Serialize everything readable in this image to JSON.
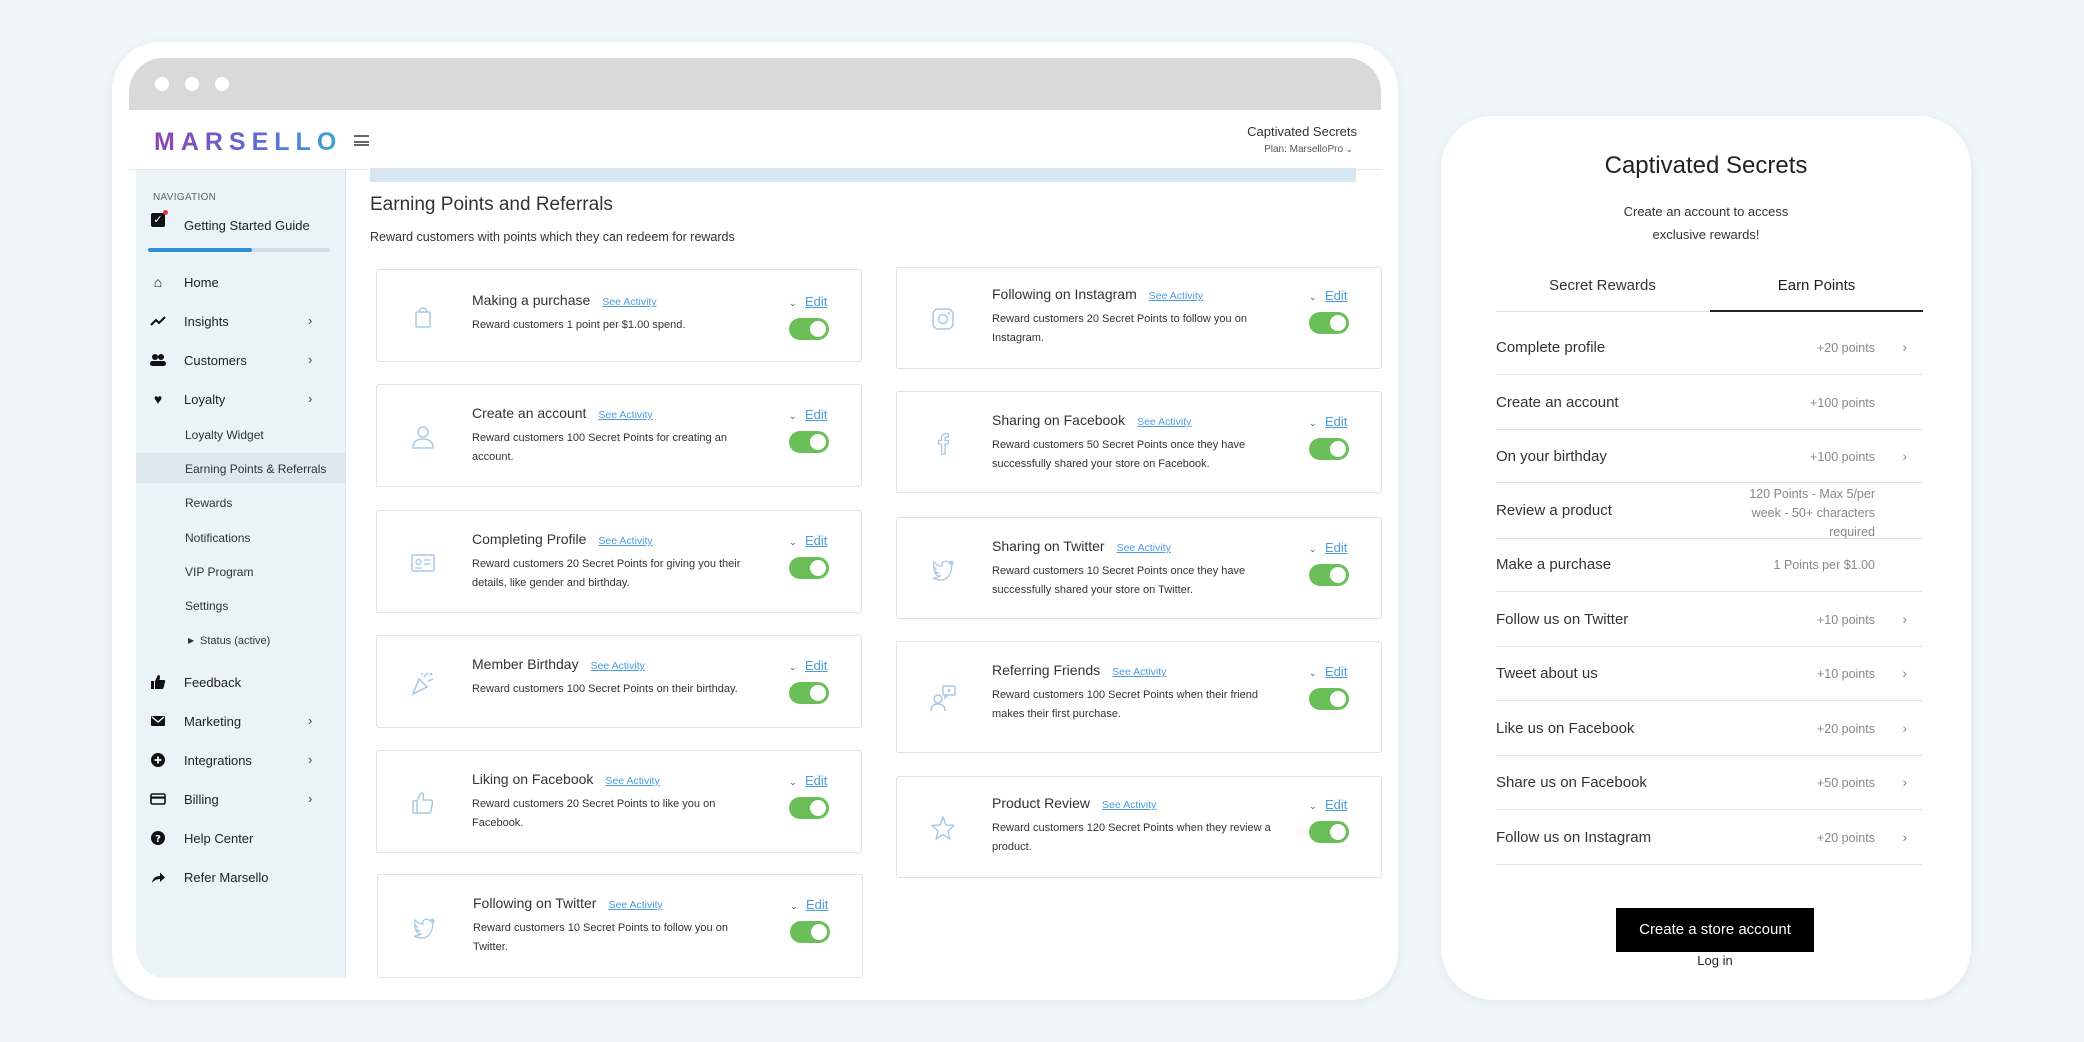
{
  "app": {
    "logo": "MARSELLO",
    "store_name": "Captivated Secrets",
    "plan": "Plan: MarselloPro",
    "plan_caret": "⌄"
  },
  "sidebar": {
    "nav_label": "NAVIGATION",
    "getting_started": "Getting Started Guide",
    "getting_started_progress": 0.57,
    "items": {
      "home": "Home",
      "insights": "Insights",
      "customers": "Customers",
      "loyalty": "Loyalty",
      "feedback": "Feedback",
      "marketing": "Marketing",
      "integrations": "Integrations",
      "billing": "Billing",
      "help": "Help Center",
      "refer": "Refer Marsello"
    },
    "loyalty_sub": {
      "widget": "Loyalty Widget",
      "earning": "Earning Points & Referrals",
      "rewards": "Rewards",
      "notifications": "Notifications",
      "vip": "VIP Program",
      "settings": "Settings",
      "status": "Status (active)"
    },
    "chevron": "›"
  },
  "main": {
    "title": "Earning Points and Referrals",
    "subtitle": "Reward customers with points which they can redeem for rewards",
    "see_activity": "See Activity",
    "edit": "Edit",
    "caret": "⌄",
    "left_cards": [
      {
        "title": "Making a purchase",
        "desc": "Reward customers 1 point per $1.00 spend.",
        "enabled": true,
        "icon": "shopping-bag-icon"
      },
      {
        "title": "Create an account",
        "desc": "Reward customers 100 Secret Points for creating an account.",
        "enabled": true,
        "icon": "user-icon"
      },
      {
        "title": "Completing Profile",
        "desc": "Reward customers 20 Secret Points for giving you their details, like gender and birthday.",
        "enabled": true,
        "icon": "id-card-icon"
      },
      {
        "title": "Member Birthday",
        "desc": "Reward customers 100 Secret Points on their birthday.",
        "enabled": true,
        "icon": "party-popper-icon"
      },
      {
        "title": "Liking on Facebook",
        "desc": "Reward customers 20 Secret Points to like you on Facebook.",
        "enabled": true,
        "icon": "thumbs-up-icon"
      },
      {
        "title": "Following on Twitter",
        "desc": "Reward customers 10 Secret Points to follow you on Twitter.",
        "enabled": true,
        "icon": "twitter-icon"
      }
    ],
    "right_cards": [
      {
        "title": "Following on Instagram",
        "desc": "Reward customers 20 Secret Points to follow you on Instagram.",
        "enabled": true,
        "icon": "instagram-icon"
      },
      {
        "title": "Sharing on Facebook",
        "desc": "Reward customers 50 Secret Points once they have successfully shared your store on Facebook.",
        "enabled": true,
        "icon": "facebook-icon"
      },
      {
        "title": "Sharing on Twitter",
        "desc": "Reward customers 10 Secret Points once they have successfully shared your store on Twitter.",
        "enabled": true,
        "icon": "twitter-icon"
      },
      {
        "title": "Referring Friends",
        "desc": "Reward customers 100 Secret Points when their friend makes their first purchase.",
        "enabled": true,
        "icon": "referral-icon"
      },
      {
        "title": "Product Review",
        "desc": "Reward customers 120 Secret Points when they review a product.",
        "enabled": true,
        "icon": "star-icon"
      }
    ]
  },
  "phone": {
    "title": "Captivated Secrets",
    "subtitle": "Create an account to access exclusive rewards!",
    "tabs": [
      "Secret Rewards",
      "Earn Points"
    ],
    "active_tab": 1,
    "rows": [
      {
        "label": "Complete profile",
        "points": "+20 points",
        "chevron": true
      },
      {
        "label": "Create an account",
        "points": "+100 points",
        "chevron": false
      },
      {
        "label": "On your birthday",
        "points": "+100 points",
        "chevron": true
      },
      {
        "label": "Review a product",
        "points": "120 Points - Max 5/per week - 50+ characters required",
        "chevron": false
      },
      {
        "label": "Make a purchase",
        "points": "1 Points per $1.00",
        "chevron": false
      },
      {
        "label": "Follow us on Twitter",
        "points": "+10 points",
        "chevron": true
      },
      {
        "label": "Tweet about us",
        "points": "+10 points",
        "chevron": true
      },
      {
        "label": "Like us on Facebook",
        "points": "+20 points",
        "chevron": true
      },
      {
        "label": "Share us on Facebook",
        "points": "+50 points",
        "chevron": true
      },
      {
        "label": "Follow us on Instagram",
        "points": "+20 points",
        "chevron": true
      }
    ],
    "chevron": "›",
    "create_button": "Create a store account",
    "login": "Log in"
  },
  "colors": {
    "accent_blue": "#4a9ce0",
    "toggle_green": "#6bbf59",
    "sidebar_bg": "#e9f3f8",
    "page_bg": "#eef6f9"
  }
}
